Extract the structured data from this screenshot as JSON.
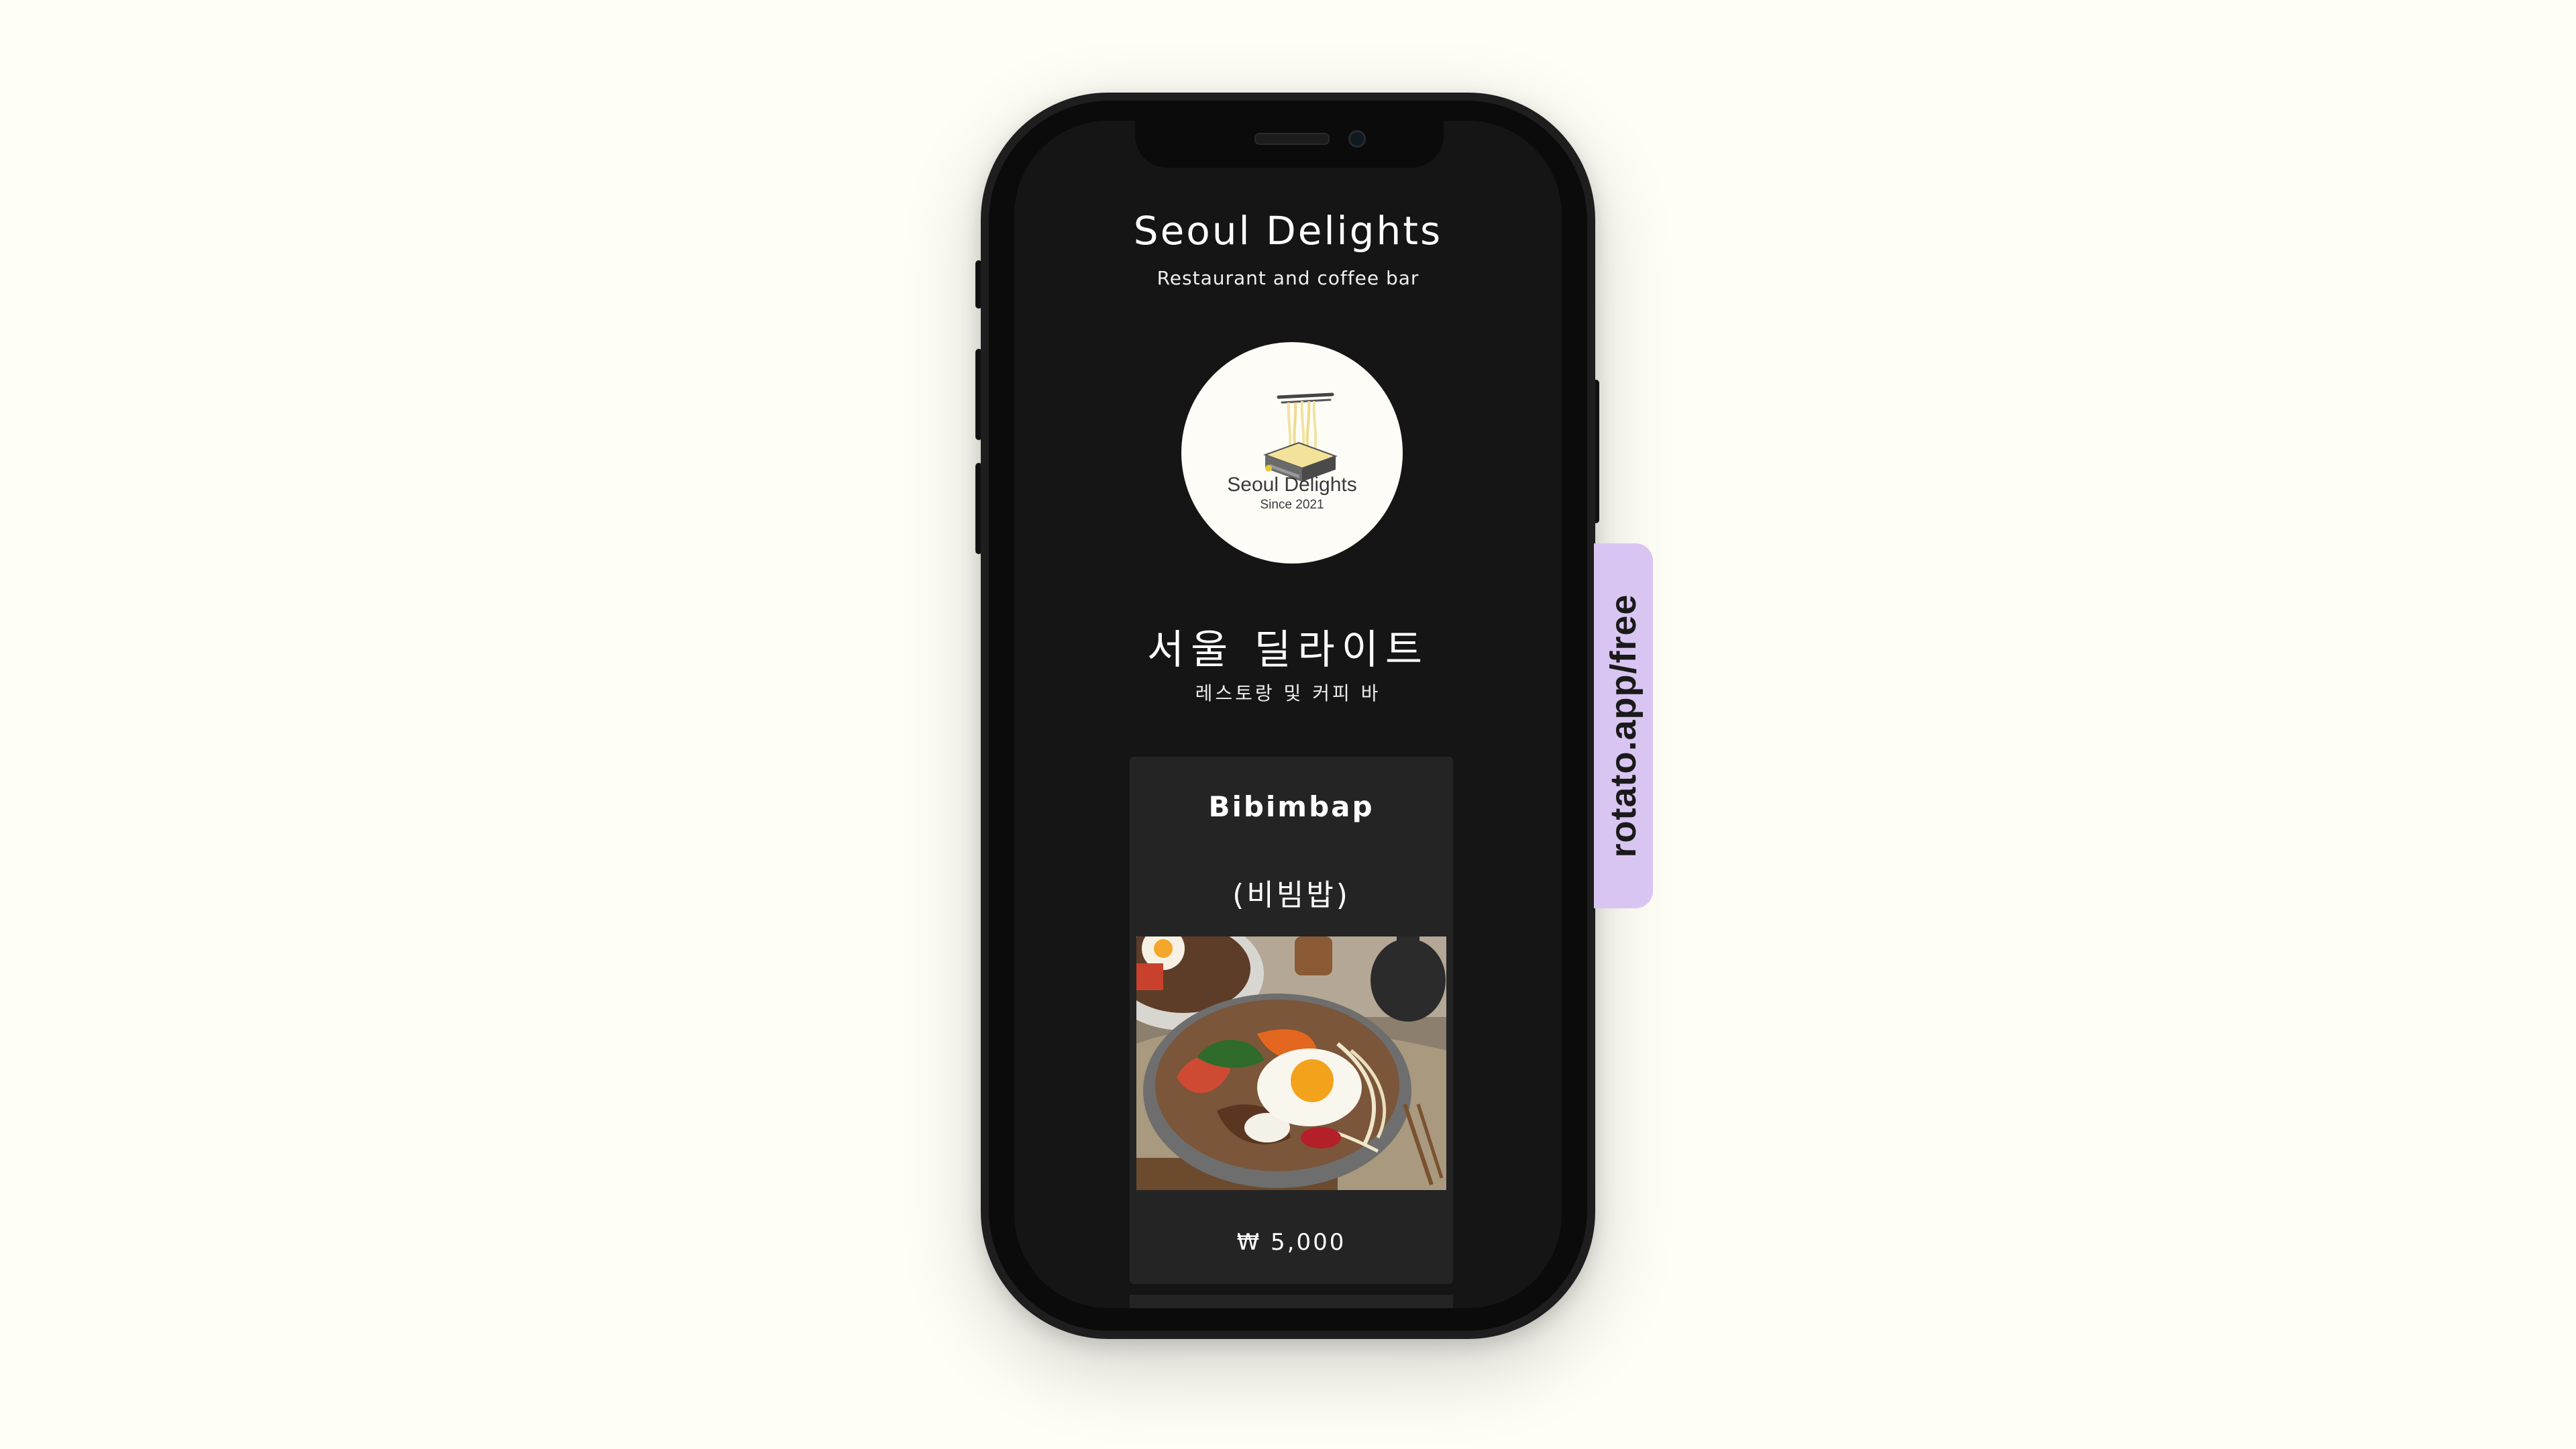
{
  "app": {
    "title": "Seoul Delights",
    "subtitle": "Restaurant and coffee bar",
    "logo": {
      "name": "Seoul Delights",
      "since": "Since 2021",
      "icon": "noodle-bowl-icon"
    },
    "korean_title": "서울 딜라이트",
    "korean_subtitle": "레스토랑 및 커피 바"
  },
  "menu_item": {
    "name": "Bibimbap",
    "korean_name": "(비빔밥)",
    "price": "₩ 5,000",
    "photo": "bibimbap-photo"
  },
  "badge": {
    "text": "rotato.app/free"
  },
  "colors": {
    "background": "#fefdf6",
    "screen": "#151515",
    "card": "#242424",
    "badge": "#d9c5f2"
  }
}
